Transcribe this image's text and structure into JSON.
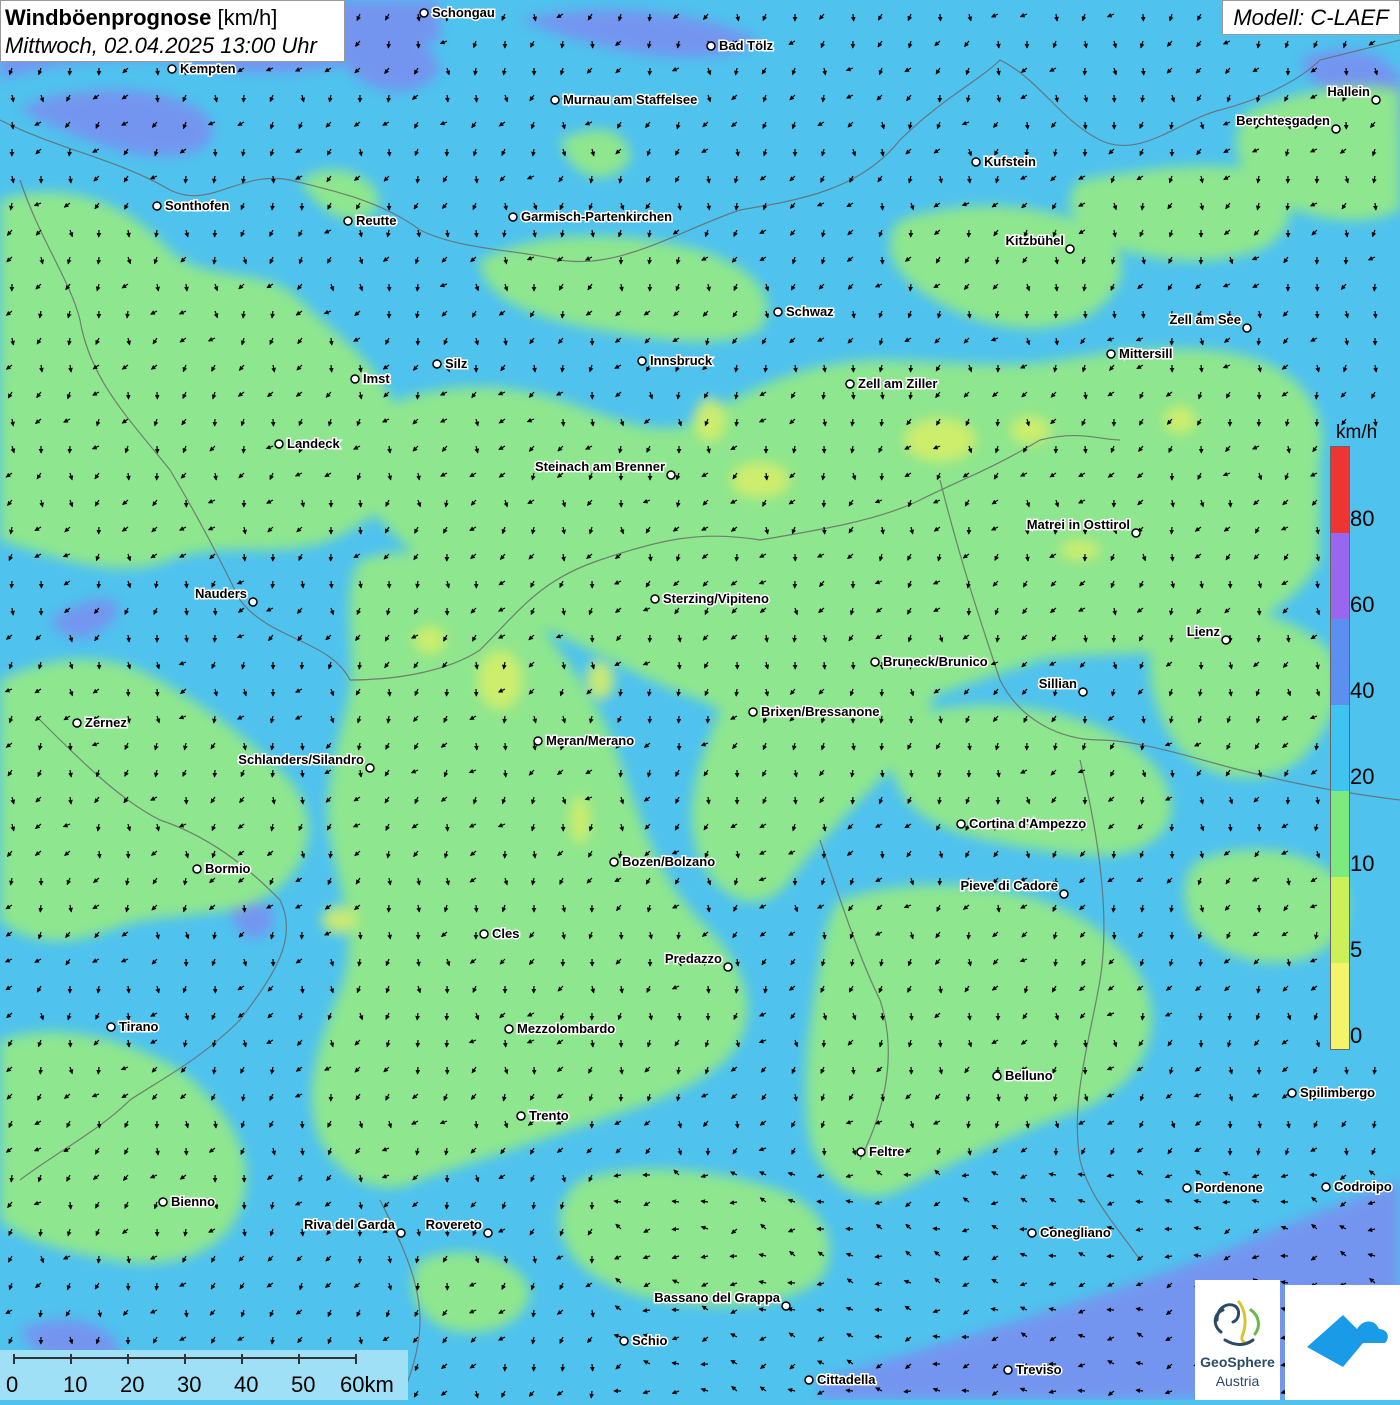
{
  "header": {
    "title_bold": "Windböenprognose",
    "title_unit": "[km/h]",
    "date": "Mittwoch, 02.04.2025 13:00 Uhr",
    "model": "Modell: C-LAEF"
  },
  "legend": {
    "unit": "km/h",
    "labels": [
      "80",
      "60",
      "40",
      "20",
      "10",
      "5",
      "0"
    ],
    "colors": [
      "#ef3434",
      "#9966ee",
      "#5b8ff0",
      "#3fc4f2",
      "#7cea7c",
      "#ccf058",
      "#f4f46a"
    ]
  },
  "scale": {
    "labels": [
      "0",
      "10",
      "20",
      "30",
      "40",
      "50",
      "60km"
    ]
  },
  "logo": {
    "line1": "GeoSphere",
    "line2": "Austria"
  },
  "map_colors": {
    "ocean_blue": "#4fc2ee",
    "green": "#8ee68e",
    "yellow": "#d4ee6a",
    "purple": "#7a8ef0"
  },
  "cities": [
    {
      "name": "Schongau"
    },
    {
      "name": "Bad Tölz"
    },
    {
      "name": "Kempten"
    },
    {
      "name": "Murnau am Staffelsee"
    },
    {
      "name": "Hallein"
    },
    {
      "name": "Berchtesgaden"
    },
    {
      "name": "Kufstein"
    },
    {
      "name": "Sonthofen"
    },
    {
      "name": "Reutte"
    },
    {
      "name": "Garmisch-Partenkirchen"
    },
    {
      "name": "Kitzbühel"
    },
    {
      "name": "Schwaz"
    },
    {
      "name": "Zell am See"
    },
    {
      "name": "Mittersill"
    },
    {
      "name": "Innsbruck"
    },
    {
      "name": "Silz"
    },
    {
      "name": "Imst"
    },
    {
      "name": "Zell am Ziller"
    },
    {
      "name": "Landeck"
    },
    {
      "name": "Steinach am Brenner"
    },
    {
      "name": "Matrei in Osttirol"
    },
    {
      "name": "Nauders"
    },
    {
      "name": "Sterzing/Vipiteno"
    },
    {
      "name": "Lienz"
    },
    {
      "name": "Bruneck/Brunico"
    },
    {
      "name": "Sillian"
    },
    {
      "name": "Brixen/Bressanone"
    },
    {
      "name": "Zernez"
    },
    {
      "name": "Meran/Merano"
    },
    {
      "name": "Schlanders/Silandro"
    },
    {
      "name": "Cortina d'Ampezzo"
    },
    {
      "name": "Bozen/Bolzano"
    },
    {
      "name": "Bormio"
    },
    {
      "name": "Pieve di Cadore"
    },
    {
      "name": "Cles"
    },
    {
      "name": "Predazzo"
    },
    {
      "name": "Tirano"
    },
    {
      "name": "Mezzolombardo"
    },
    {
      "name": "Belluno"
    },
    {
      "name": "Spilimbergo"
    },
    {
      "name": "Trento"
    },
    {
      "name": "Feltre"
    },
    {
      "name": "Pordenone"
    },
    {
      "name": "Codroipo"
    },
    {
      "name": "Bienno"
    },
    {
      "name": "Riva del Garda"
    },
    {
      "name": "Rovereto"
    },
    {
      "name": "Conegliano"
    },
    {
      "name": "Bassano del Grappa"
    },
    {
      "name": "Schio"
    },
    {
      "name": "Treviso"
    },
    {
      "name": "Cittadella"
    }
  ]
}
